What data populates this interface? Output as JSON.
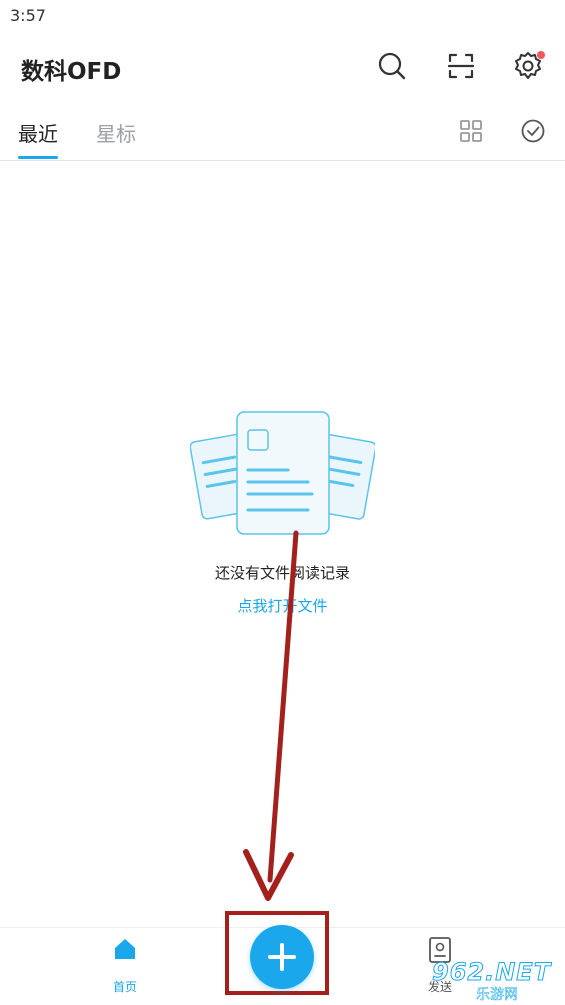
{
  "status_bar": {
    "time": "3:57"
  },
  "header": {
    "title": "数科OFD",
    "icons": [
      "search-icon",
      "scan-icon",
      "settings-icon"
    ],
    "settings_has_notification": true
  },
  "tabs": [
    {
      "label": "最近",
      "active": true
    },
    {
      "label": "星标",
      "active": false
    }
  ],
  "tab_tools": [
    "grid-view-icon",
    "select-check-icon"
  ],
  "empty_state": {
    "message": "还没有文件阅读记录",
    "action": "点我打开文件"
  },
  "bottom_nav": {
    "home_label": "首页",
    "send_label": "发送"
  },
  "fab": {
    "icon": "plus-icon"
  },
  "watermark": {
    "number": "962.NET",
    "site": "乐游网"
  },
  "colors": {
    "accent": "#1aa7ec",
    "annotation": "#a3201c",
    "notification": "#ef5b5b",
    "inactive_tab": "#9aa0a6"
  }
}
